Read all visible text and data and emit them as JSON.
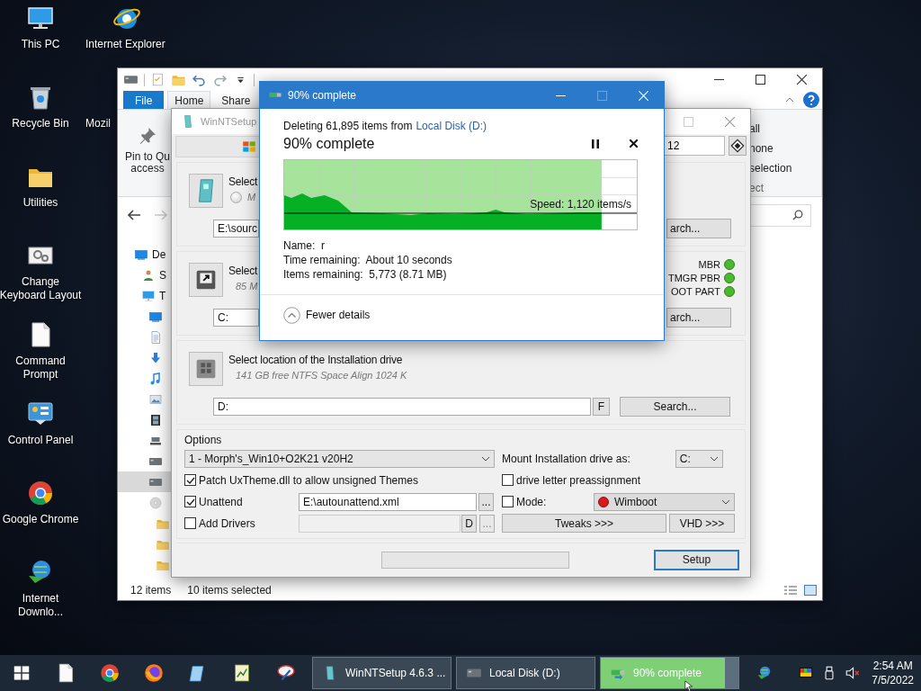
{
  "desktop": {
    "icons": [
      {
        "label": "This PC",
        "kind": "pc"
      },
      {
        "label": "Recycle Bin",
        "kind": "bin"
      },
      {
        "label": "Utilities",
        "kind": "folder"
      },
      {
        "label": "Change\nKeyboard Layout",
        "kind": "keyboard"
      },
      {
        "label": "Command\nPrompt",
        "kind": "file"
      },
      {
        "label": "Control Panel",
        "kind": "panel"
      },
      {
        "label": "Google Chrome",
        "kind": "chrome"
      },
      {
        "label": "Internet\nDownlo...",
        "kind": "download"
      }
    ],
    "icons_column_2": [
      {
        "label": "Internet Explorer",
        "kind": "ie"
      },
      {
        "label": "Mozil"
      }
    ]
  },
  "explorer": {
    "quick_access": [
      {
        "kind": "drive"
      },
      {
        "kind": "props"
      },
      {
        "kind": "folder"
      },
      {
        "kind": "undo"
      },
      {
        "kind": "redo"
      },
      {
        "kind": "caret"
      }
    ],
    "ribbon_tabs": [
      {
        "label": "File",
        "kind": "file",
        "selected": false
      },
      {
        "label": "Home",
        "kind": "tab",
        "selected": true
      },
      {
        "label": "Share",
        "kind": "tab",
        "selected": false
      }
    ],
    "pin_button": "Pin to Qu\naccess",
    "select_group": {
      "items": [
        "all",
        "none",
        "selection"
      ],
      "label": "ect"
    },
    "nav_tree": [
      {
        "label": "De",
        "kind": "desktop",
        "selected": false,
        "children": [
          {
            "label": "S",
            "kind": "user",
            "selected": false
          },
          {
            "label": "T",
            "kind": "pc",
            "selected": false,
            "children": [
              {
                "kind": "desktop",
                "selected": false
              },
              {
                "kind": "doc",
                "selected": false
              },
              {
                "kind": "down",
                "selected": false
              },
              {
                "kind": "music",
                "selected": false
              },
              {
                "kind": "picture",
                "selected": false
              },
              {
                "kind": "video",
                "selected": false
              },
              {
                "kind": "netdrive",
                "selected": false
              },
              {
                "kind": "drive",
                "selected": false
              },
              {
                "kind": "drive",
                "selected": true
              },
              {
                "kind": "cd",
                "selected": false,
                "children": [
                  {
                    "kind": "folder",
                    "selected": false
                  },
                  {
                    "kind": "folder",
                    "selected": false
                  },
                  {
                    "kind": "folder",
                    "selected": false
                  }
                ]
              }
            ]
          }
        ]
      }
    ],
    "status": {
      "count": "12 items",
      "selection": "10 items selected"
    }
  },
  "winntsetup": {
    "title": "WinNTSetup",
    "version_field": "12",
    "sections": [
      {
        "kind": "source",
        "heading": "Select",
        "note": "M",
        "radio": {
          "selected": false
        },
        "path": "E:\\sourc",
        "button": "arch..."
      },
      {
        "kind": "boot",
        "heading": "Select",
        "note": "85 M",
        "path": "C:",
        "button": "arch...",
        "statuses": [
          {
            "label": "MBR",
            "color": "#4cb82e"
          },
          {
            "label": "TMGR PBR",
            "color": "#4cb82e"
          },
          {
            "label": "OOT PART",
            "color": "#4cb82e"
          }
        ]
      },
      {
        "kind": "install",
        "heading": "Select location of the Installation drive",
        "note": "141 GB free NTFS Space Align 1024 K",
        "path": "D:",
        "format_button": "F",
        "button": "Search..."
      }
    ],
    "options": {
      "title": "Options",
      "edition": "1 - Morph's_Win10+O2K21 v20H2",
      "mount_label": "Mount Installation drive as:",
      "mount_drive": "C:",
      "patch": {
        "label": "Patch UxTheme.dll to allow unsigned Themes",
        "checked": true
      },
      "preassign": {
        "label": "drive letter preassignment",
        "checked": false
      },
      "unattend": {
        "label": "Unattend",
        "checked": true,
        "value": "E:\\autounattend.xml",
        "browse": "..."
      },
      "mode": {
        "label": "Mode:",
        "checked": false,
        "value": "Wimboot",
        "color": "#d81a1a"
      },
      "drivers": {
        "label": "Add Drivers",
        "checked": false,
        "button": "D",
        "browse": "..."
      },
      "tweaks": "Tweaks >>>",
      "vhd": "VHD >>>"
    },
    "footer": {
      "setup": "Setup"
    }
  },
  "dialog": {
    "title": "90% complete",
    "summary": "Deleting 61,895 items from",
    "summary_link": "Local Disk (D:)",
    "heading": "90% complete",
    "progress": {
      "level": 0.9
    },
    "speed": "Speed: 1,120 items/s",
    "details": [
      "Name:  r",
      "Time remaining:  About 10 seconds",
      "Items remaining:  5,773 (8.71 MB)"
    ],
    "toggle": "Fewer details"
  },
  "taskbar": {
    "pinned": [
      {
        "kind": "file"
      },
      {
        "kind": "chrome"
      },
      {
        "kind": "firefox"
      },
      {
        "kind": "notepad"
      },
      {
        "kind": "sheet"
      },
      {
        "kind": "tool"
      }
    ],
    "tasks": [
      {
        "label": "WinNTSetup 4.6.3   ...",
        "kind": "setup",
        "selected": false
      },
      {
        "label": "Local Disk (D:)",
        "kind": "drive",
        "selected": false
      },
      {
        "label": "90% complete",
        "kind": "copy",
        "selected": true,
        "level": 0.9
      }
    ],
    "tray": [
      {
        "kind": "download"
      },
      {
        "kind": "display"
      },
      {
        "kind": "usb"
      },
      {
        "kind": "mute"
      }
    ],
    "time": "2:54 AM",
    "date": "7/5/2022"
  }
}
